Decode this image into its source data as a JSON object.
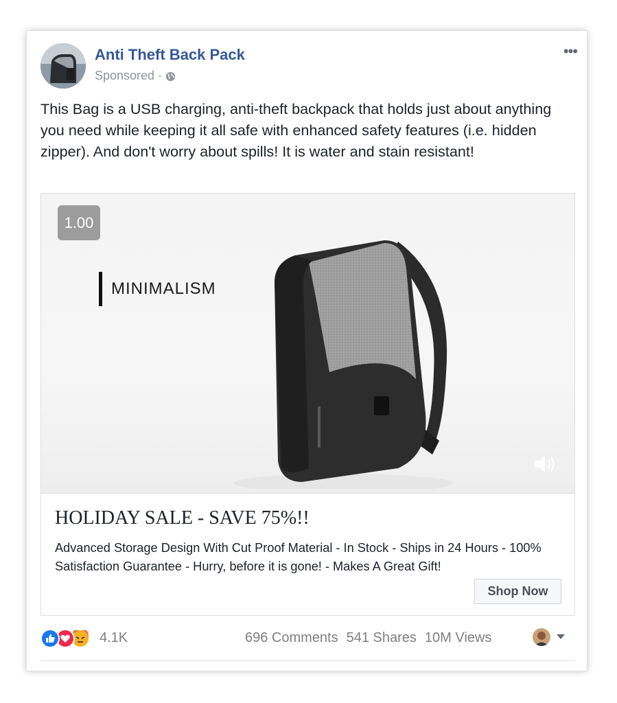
{
  "post": {
    "page_name": "Anti Theft Back Pack",
    "sponsored": "Sponsored",
    "separator": "·",
    "text": "This Bag is a USB charging, anti-theft backpack that holds just about anything you need while keeping it all safe with enhanced safety features (i.e. hidden zipper). And don't worry about spills! It is water and stain resistant!"
  },
  "media": {
    "playback_speed": "1.00",
    "caption": "MINIMALISM"
  },
  "link": {
    "title": "HOLIDAY SALE - SAVE 75%!!",
    "description": "Advanced Storage Design With Cut Proof Material - In Stock - Ships in 24 Hours - 100% Satisfaction Guarantee - Hurry, before it is gone! - Makes A Great Gift!",
    "cta": "Shop Now"
  },
  "footer": {
    "reaction_count": "4.1K",
    "comments": "696 Comments",
    "shares": "541 Shares",
    "views": "10M Views"
  },
  "icons": {
    "more": "more-options-icon",
    "globe": "globe-icon",
    "volume": "volume-icon",
    "like": "like-reaction-icon",
    "love": "love-reaction-icon",
    "angry": "angry-reaction-icon",
    "dropdown": "chevron-down-icon"
  },
  "colors": {
    "link": "#365899",
    "meta": "#90949c",
    "like": "#1877f2",
    "love": "#f0284a",
    "angry": "#f7b125"
  }
}
